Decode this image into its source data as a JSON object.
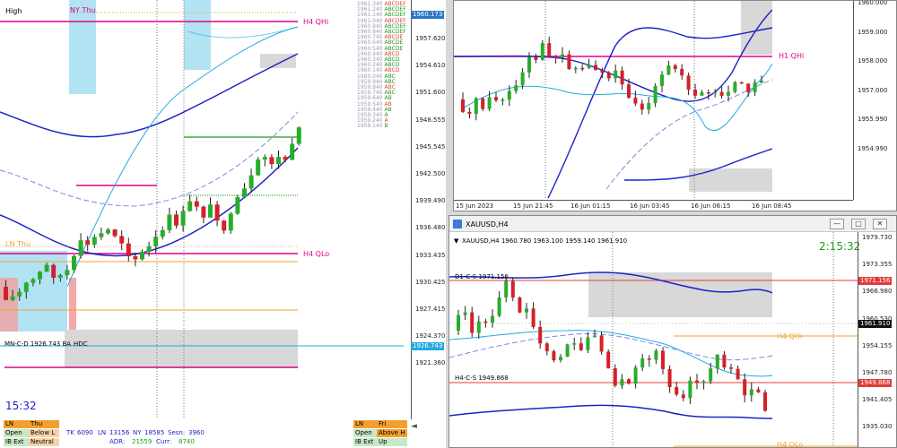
{
  "colors": {
    "bull": "#27ad2b",
    "bear": "#d5202a",
    "magenta": "#e4008a",
    "band": "#1c22c8",
    "cyan": "#23a9e0",
    "orange": "#f0a030",
    "green_line": "#1e9a1e",
    "zone": "#d8d8d8",
    "red_line": "#e03c3c"
  },
  "left_chart": {
    "top_label": "High",
    "ny_label": "NY Thu",
    "h4_qhi": "H4 QHi",
    "h4_qlo": "H4 QLo",
    "ln_thu": "LN Thu",
    "mn_label": "MN-C-D 1926.743 BA",
    "hdc_label": "HDC",
    "time": "15:32",
    "price_axis": [
      "1957.620",
      "1954.610",
      "1951.600",
      "1948.555",
      "1945.545",
      "1942.500",
      "1939.490",
      "1936.480",
      "1933.435",
      "1930.425",
      "1927.415",
      "1924.370",
      "1921.360"
    ],
    "price_tag_top": "1960.173",
    "price_tag_mid": "1926.743",
    "ladder": [
      {
        "price": "1961.340",
        "code": "ABCDEF"
      },
      {
        "price": "1961.240",
        "code": "ABCDEF"
      },
      {
        "price": "1961.140",
        "code": "ABCDEF"
      },
      {
        "price": "1961.040",
        "code": "ABCDEF"
      },
      {
        "price": "1960.940",
        "code": "ABCDEF"
      },
      {
        "price": "1960.840",
        "code": "ABCDEF"
      },
      {
        "price": "1960.740",
        "code": "ABCDE"
      },
      {
        "price": "1960.640",
        "code": "ABCDE"
      },
      {
        "price": "1960.540",
        "code": "ABCDE"
      },
      {
        "price": "1960.440",
        "code": "ABCD"
      },
      {
        "price": "1960.340",
        "code": "ABCD"
      },
      {
        "price": "1960.240",
        "code": "ABCD"
      },
      {
        "price": "1960.140",
        "code": "ABCD"
      },
      {
        "price": "1960.040",
        "code": "ABC"
      },
      {
        "price": "1959.940",
        "code": "ABC"
      },
      {
        "price": "1959.840",
        "code": "ABC"
      },
      {
        "price": "1959.740",
        "code": "ABC"
      },
      {
        "price": "1959.640",
        "code": "AB"
      },
      {
        "price": "1959.540",
        "code": "AB"
      },
      {
        "price": "1959.440",
        "code": "AB"
      },
      {
        "price": "1959.340",
        "code": "A"
      },
      {
        "price": "1959.240",
        "code": "A"
      },
      {
        "price": "1959.140",
        "code": "B"
      }
    ]
  },
  "status_bar": {
    "ln": "LN",
    "thu": "Thu",
    "open": "Open",
    "below_l": "Below L",
    "ib_ext": "IB Ext",
    "neutral": "Neutral",
    "tk_label": "TK",
    "tk_val": "6090",
    "ln_label": "LN",
    "ln_val": "13156",
    "ny_label": "NY",
    "ny_val": "18585",
    "sesn_label": "Sesn:",
    "sesn_val": "3960",
    "adr_label": "ADR:",
    "adr_val": "21559",
    "curr_label": "Curr:",
    "curr_val": "8740",
    "right_ln": "LN",
    "right_fri": "Fri",
    "right_open": "Open",
    "right_above": "Above H",
    "right_ibext": "IB Ext",
    "right_up": "Up"
  },
  "top_right_chart": {
    "h1_qhi": "H1 QHi",
    "price_axis": [
      "1960.000",
      "1959.000",
      "1958.000",
      "1957.000",
      "1955.990",
      "1954.990"
    ],
    "time_axis": [
      "15 Jun 2023",
      "15 Jun 21:45",
      "16 Jun 01:15",
      "16 Jun 03:45",
      "16 Jun 06:15",
      "16 Jun 08:45"
    ]
  },
  "bottom_right_chart": {
    "window_title": "XAUUSD,H4",
    "ohlc": "XAUUSD,H4  1960.780 1963.100 1959.140 1961.910",
    "timer": "2:15:32",
    "d1_label": "D1-C-S 1971.156",
    "h4_label": "H4-C-S 1949.868",
    "h4_qhi": "H4 QHi",
    "h4_qlo": "H4 QLo",
    "price_axis": [
      "1979.730",
      "1973.355",
      "1966.980",
      "1960.530",
      "1954.155",
      "1947.780",
      "1941.405",
      "1935.030"
    ],
    "tag_top": "1971.156",
    "tag_mid": "1961.910",
    "tag_low": "1949.868"
  }
}
